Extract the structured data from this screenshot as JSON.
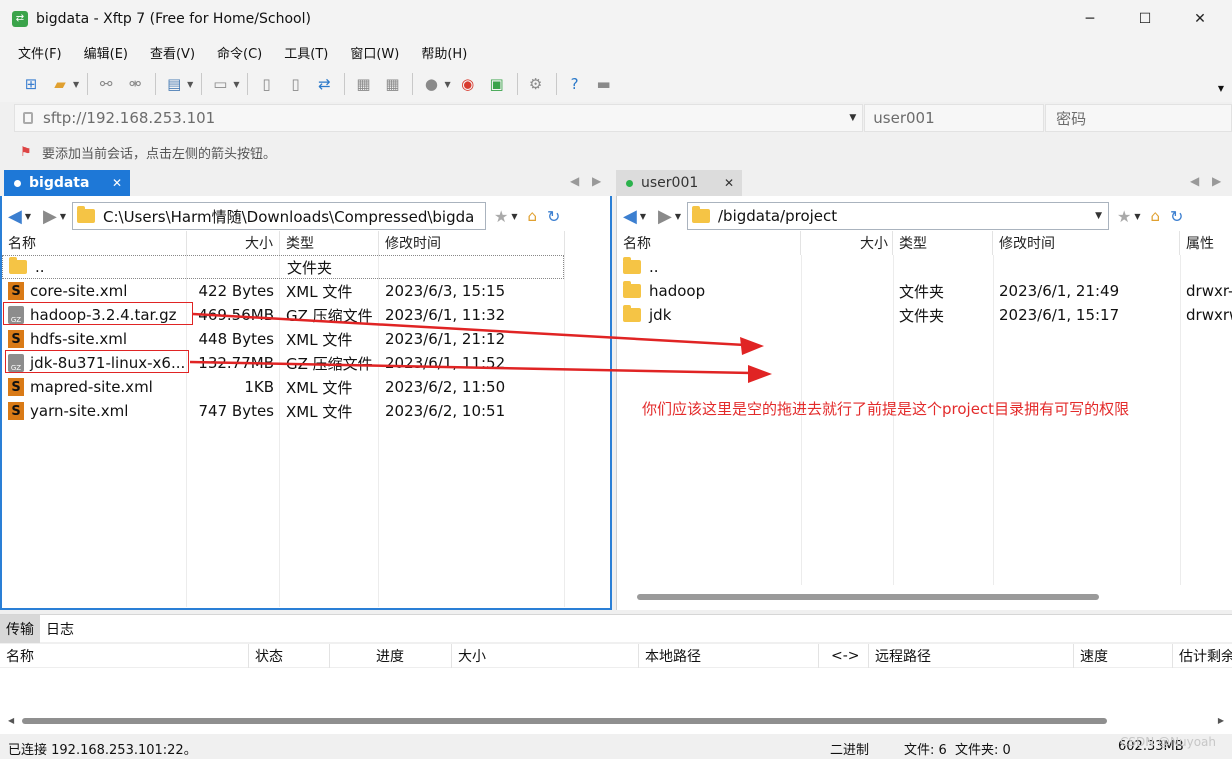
{
  "window": {
    "title": "bigdata - Xftp 7 (Free for Home/School)",
    "minimize_glyph": "─",
    "maximize_glyph": "☐",
    "close_glyph": "✕"
  },
  "menu": [
    "文件(F)",
    "编辑(E)",
    "查看(V)",
    "命令(C)",
    "工具(T)",
    "窗口(W)",
    "帮助(H)"
  ],
  "address": {
    "url": "sftp://192.168.253.101",
    "username_placeholder": "user001",
    "password_placeholder": "密码"
  },
  "hint": "要添加当前会话，点击左侧的箭头按钮。",
  "left_pane": {
    "tab_label": "bigdata",
    "path": "C:\\Users\\Harm情随\\Downloads\\Compressed\\bigda",
    "columns": [
      "名称",
      "大小",
      "类型",
      "修改时间"
    ],
    "rows": [
      {
        "name": "..",
        "size": "",
        "type": "文件夹",
        "modified": "",
        "icon": "folder-icon"
      },
      {
        "name": "core-site.xml",
        "size": "422 Bytes",
        "type": "XML 文件",
        "modified": "2023/6/3, 15:15",
        "icon": "xml-file-icon"
      },
      {
        "name": "hadoop-3.2.4.tar.gz",
        "size": "469.56MB",
        "type": "GZ 压缩文件",
        "modified": "2023/6/1, 11:32",
        "icon": "gz-archive-icon"
      },
      {
        "name": "hdfs-site.xml",
        "size": "448 Bytes",
        "type": "XML 文件",
        "modified": "2023/6/1, 21:12",
        "icon": "xml-file-icon"
      },
      {
        "name": "jdk-8u371-linux-x6...",
        "size": "132.77MB",
        "type": "GZ 压缩文件",
        "modified": "2023/6/1, 11:52",
        "icon": "gz-archive-icon"
      },
      {
        "name": "mapred-site.xml",
        "size": "1KB",
        "type": "XML 文件",
        "modified": "2023/6/2, 11:50",
        "icon": "xml-file-icon"
      },
      {
        "name": "yarn-site.xml",
        "size": "747 Bytes",
        "type": "XML 文件",
        "modified": "2023/6/2, 10:51",
        "icon": "xml-file-icon"
      }
    ]
  },
  "right_pane": {
    "tab_label": "user001",
    "path": "/bigdata/project",
    "columns": [
      "名称",
      "大小",
      "类型",
      "修改时间",
      "属性"
    ],
    "rows": [
      {
        "name": "..",
        "size": "",
        "type": "",
        "modified": "",
        "attr": ""
      },
      {
        "name": "hadoop",
        "size": "",
        "type": "文件夹",
        "modified": "2023/6/1, 21:49",
        "attr": "drwxr-"
      },
      {
        "name": "jdk",
        "size": "",
        "type": "文件夹",
        "modified": "2023/6/1, 15:17",
        "attr": "drwxrw"
      }
    ]
  },
  "annotation": "你们应该这里是空的拖进去就行了前提是这个project目录拥有可写的权限",
  "annotation_color": "#e32b2b",
  "transfer": {
    "tabs": [
      "传输",
      "日志"
    ],
    "columns": [
      "名称",
      "状态",
      "进度",
      "大小",
      "本地路径",
      "<->",
      "远程路径",
      "速度",
      "估计剩余"
    ]
  },
  "status": {
    "connection": "已连接 192.168.253.101:22。",
    "mode": "二进制",
    "counts": "文件: 6  文件夹: 0",
    "total": "602.33MB",
    "watermark": "CSDN @Nuyoah"
  },
  "colors": {
    "accent": "#1e78d7",
    "folder": "#f5c445",
    "annotation_red": "#e32b2b"
  }
}
